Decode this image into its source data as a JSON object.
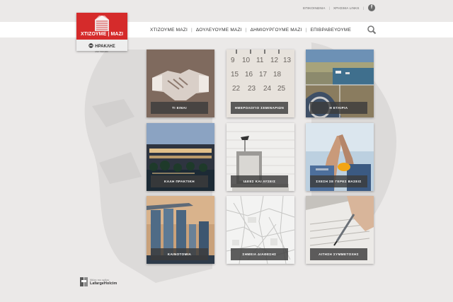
{
  "top_links": [
    "ΕΠΙΚΟΙΝΩΝΙΑ",
    "ΧΡΗΣΙΜΑ LINKS"
  ],
  "top_links_separator": "|",
  "facebook_glyph": "f",
  "logo": {
    "title": "ΧΤΙΖΟΥΜΕ | ΜΑΖΙ",
    "brand": "ΗΡΑΚΛΗΣ",
    "brand_sub": "ΑΓΕΤ ΗΡΑΚΛΗΣ",
    "brand_color": "#d52b2b"
  },
  "nav": {
    "items": [
      "ΧΤΙΖΟΥΜΕ ΜΑΖΙ",
      "ΔΟΥΛΕΥΟΥΜΕ ΜΑΖΙ",
      "ΔΗΜΙΟΥΡΓΟΥΜΕ ΜΑΖΙ",
      "ΕΠΙΒΡΑΒΕΥΟΥΜΕ"
    ],
    "separator": "|"
  },
  "tiles": [
    {
      "label": "ΤΙ ΕΙΝΑΙ",
      "image": "handshake"
    },
    {
      "label": "ΗΜΕΡΟΛΟΓΙΟ ΣΕΜΙΝΑΡΙΩΝ",
      "image": "calendar"
    },
    {
      "label": "Η ΕΤΑΙΡΙΑ",
      "image": "harbor-company"
    },
    {
      "label": "ΚΑΛΗ ΠΡΑΚΤΙΚΗ",
      "image": "modern-building"
    },
    {
      "label": "ΙΔΕΕΣ ΚΑΙ ΛΥΣΕΙΣ",
      "image": "concrete-furniture"
    },
    {
      "label": "ΣΧΕΣΗ ΣΕ ΓΕΡΕΣ ΒΑΣΕΙΣ",
      "image": "high-five-workers"
    },
    {
      "label": "ΚΑΙΝΟΤΟΜΙΑ",
      "image": "skyscrapers"
    },
    {
      "label": "ΣΗΜΕΙΑ ΔΙΑΘΕΣΗΣ",
      "image": "map"
    },
    {
      "label": "ΑΙΤΗΣΗ ΣΥΜΜΕΤΟΧΗΣ",
      "image": "signing-pen"
    }
  ],
  "footer": {
    "member_text": "Μέλος του ομίλου",
    "group_name": "LafargeHolcim"
  }
}
